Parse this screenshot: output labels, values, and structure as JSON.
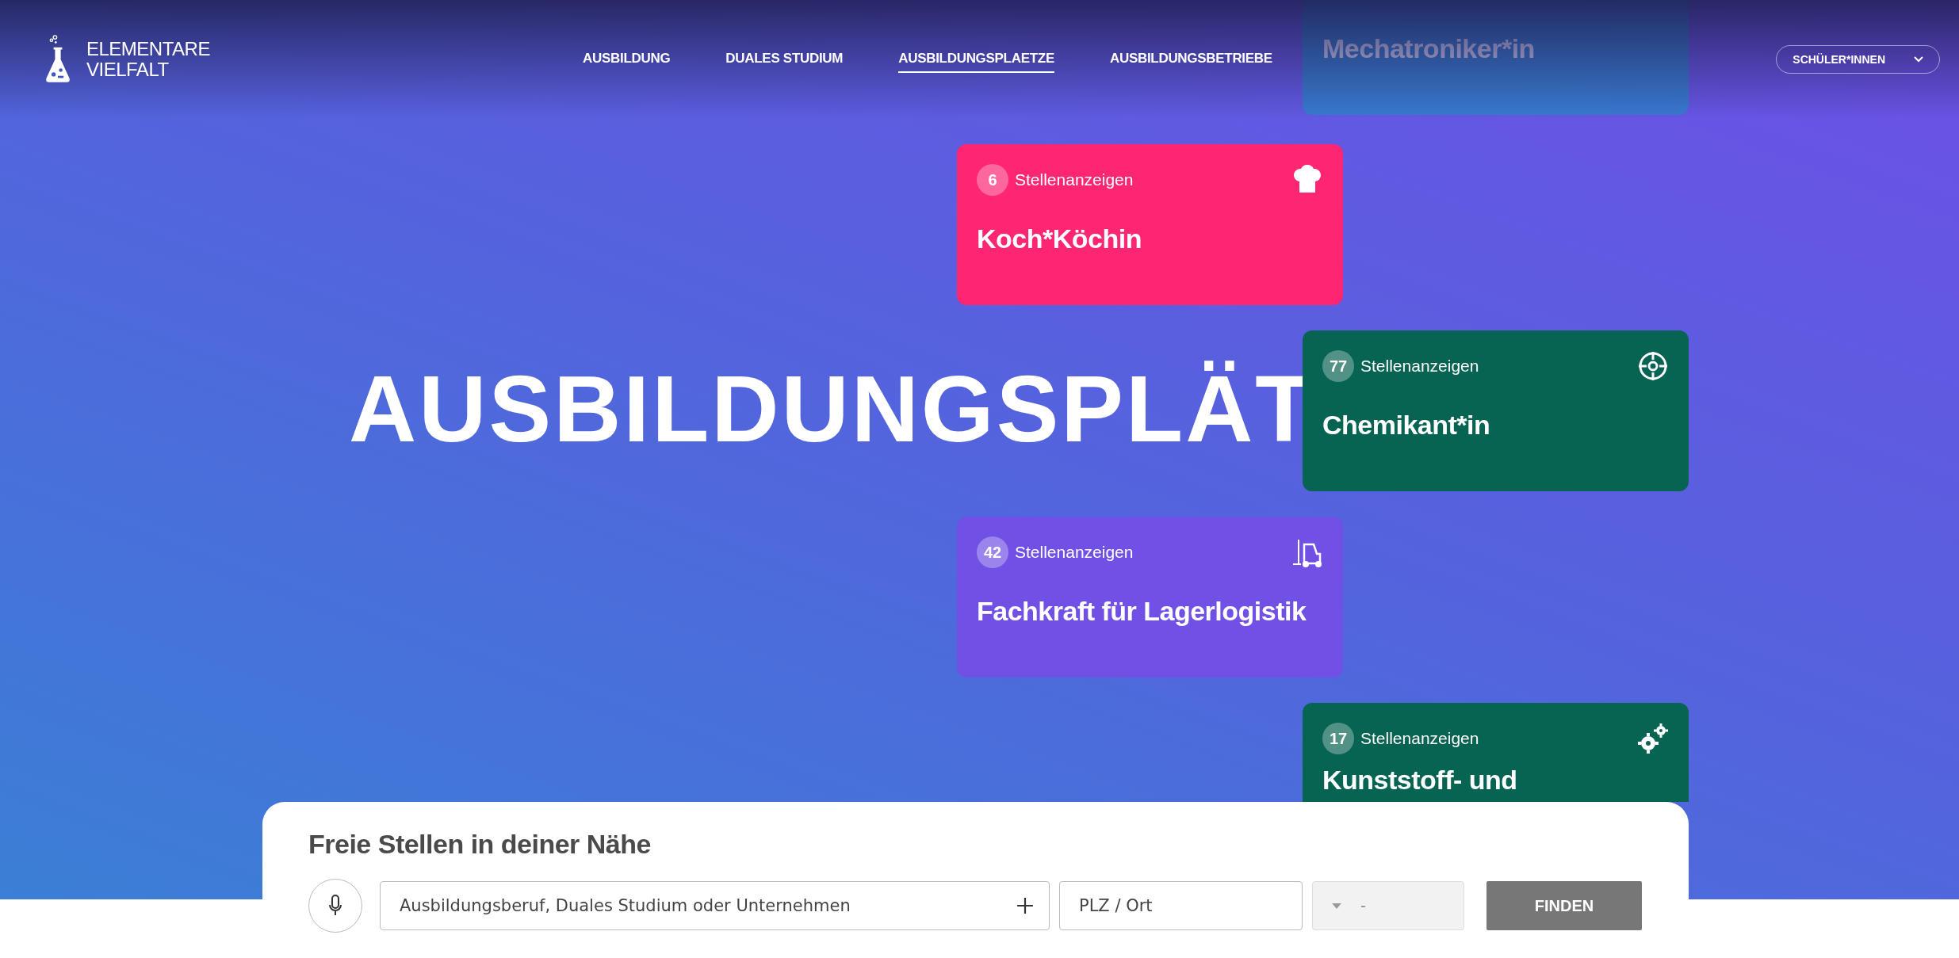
{
  "brand": {
    "lines": [
      "ELEMENTARE",
      "VIELFALT"
    ]
  },
  "nav": [
    {
      "label": "AUSBILDUNG",
      "selected": false
    },
    {
      "label": "DUALES STUDIUM",
      "selected": false
    },
    {
      "label": "AUSBILDUNGSPLAETZE",
      "selected": true
    },
    {
      "label": "AUSBILDUNGSBETRIEBE",
      "selected": false
    }
  ],
  "audience_menu": {
    "label": "SCHÜLER*INNEN"
  },
  "hero": {
    "heading": "AUSBILDUNGSPLÄT"
  },
  "job_cards": [
    {
      "kind": "wrench",
      "title": "Mechatroniker*in",
      "color": "#2a86c9"
    },
    {
      "kind": "chef-hat",
      "count": "6",
      "label": "Stellenanzeigen",
      "title": "Koch*Köchin",
      "color": "#fe2673"
    },
    {
      "kind": "target",
      "count": "77",
      "label": "Stellenanzeigen",
      "title": "Chemikant*in",
      "color": "#086452"
    },
    {
      "kind": "forklift",
      "count": "42",
      "label": "Stellenanzeigen",
      "title": "Fachkraft für Lagerlogistik",
      "color": "#7150e6"
    },
    {
      "kind": "gears",
      "count": "17",
      "label": "Stellenanzeigen",
      "title": "Kunststoff- und",
      "color": "#086452"
    }
  ],
  "search": {
    "title": "Freie Stellen in deiner Nähe",
    "query": {
      "placeholder": "Ausbildungsberuf, Duales Studium oder Unternehmen"
    },
    "location": {
      "placeholder": "PLZ / Ort"
    },
    "radius": {
      "value": "-"
    },
    "button": "FINDEN"
  }
}
